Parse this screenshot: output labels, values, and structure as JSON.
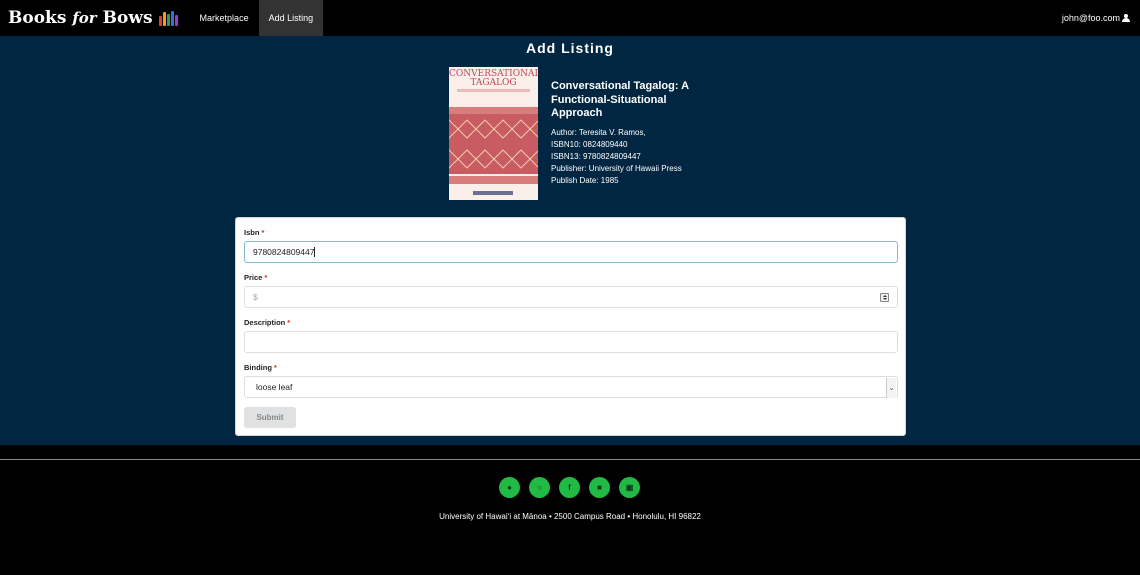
{
  "navbar": {
    "brand_books": "Books",
    "brand_for": "for",
    "brand_bows": "Bows",
    "items": [
      {
        "label": "Marketplace"
      },
      {
        "label": "Add Listing"
      }
    ],
    "user_email": "john@foo.com"
  },
  "page": {
    "title": "Add Listing"
  },
  "book": {
    "cover_title": "CONVERSATIONAL TAGALOG",
    "title": "Conversational Tagalog: A Functional-Situational Approach",
    "author": "Author: Teresita V. Ramos,",
    "isbn10": "ISBN10: 0824809440",
    "isbn13": "ISBN13: 9780824809447",
    "publisher": "Publisher: University of Hawaii Press",
    "publish_date": "Publish Date: 1985"
  },
  "form": {
    "isbn": {
      "label": "Isbn",
      "value": "9780824809447"
    },
    "price": {
      "label": "Price",
      "placeholder": "$"
    },
    "description": {
      "label": "Description",
      "value": ""
    },
    "binding": {
      "label": "Binding",
      "value": "loose leaf"
    },
    "required_mark": "*",
    "submit_label": "Submit"
  },
  "footer": {
    "socials": [
      {
        "icon": "github-icon"
      },
      {
        "icon": "instagram-icon"
      },
      {
        "icon": "facebook-icon"
      },
      {
        "icon": "discord-icon"
      },
      {
        "icon": "linkedin-icon"
      }
    ],
    "address": "University of Hawaiʻi at Mānoa • 2500 Campus Road • Honolulu, HI 96822"
  },
  "colors": {
    "main_bg": "#002642",
    "accent_green": "#21ba45",
    "required_red": "#db2828"
  }
}
